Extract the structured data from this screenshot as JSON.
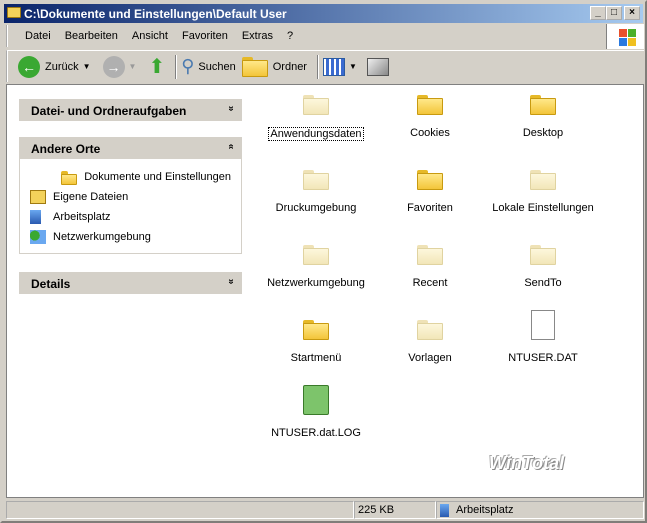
{
  "window": {
    "title": "C:\\Dokumente und Einstellungen\\Default User",
    "minimize": "_",
    "maximize": "□",
    "close": "×"
  },
  "menu": [
    "Datei",
    "Bearbeiten",
    "Ansicht",
    "Favoriten",
    "Extras",
    "?"
  ],
  "toolbar": {
    "back": "Zurück",
    "search": "Suchen",
    "folders": "Ordner"
  },
  "tasks": {
    "file_tasks": "Datei- und Ordneraufgaben",
    "other_places": "Andere Orte",
    "places": [
      "Dokumente und Einstellungen",
      "Eigene Dateien",
      "Arbeitsplatz",
      "Netzwerkumgebung"
    ],
    "details": "Details",
    "collapse_down": "»",
    "collapse_up": "«"
  },
  "items": [
    {
      "name": "Anwendungsdaten",
      "type": "folder-hidden",
      "selected": true
    },
    {
      "name": "Cookies",
      "type": "folder"
    },
    {
      "name": "Desktop",
      "type": "folder"
    },
    {
      "name": "Druckumgebung",
      "type": "folder-hidden"
    },
    {
      "name": "Favoriten",
      "type": "folder"
    },
    {
      "name": "Lokale Einstellungen",
      "type": "folder-hidden"
    },
    {
      "name": "Netzwerkumgebung",
      "type": "folder-hidden"
    },
    {
      "name": "Recent",
      "type": "folder-hidden"
    },
    {
      "name": "SendTo",
      "type": "folder-hidden"
    },
    {
      "name": "Startmenü",
      "type": "folder"
    },
    {
      "name": "Vorlagen",
      "type": "folder-hidden"
    },
    {
      "name": "NTUSER.DAT",
      "type": "file"
    },
    {
      "name": "NTUSER.dat.LOG",
      "type": "log"
    }
  ],
  "status": {
    "size": "225 KB",
    "zone": "Arbeitsplatz"
  },
  "watermark": "WinTotal"
}
